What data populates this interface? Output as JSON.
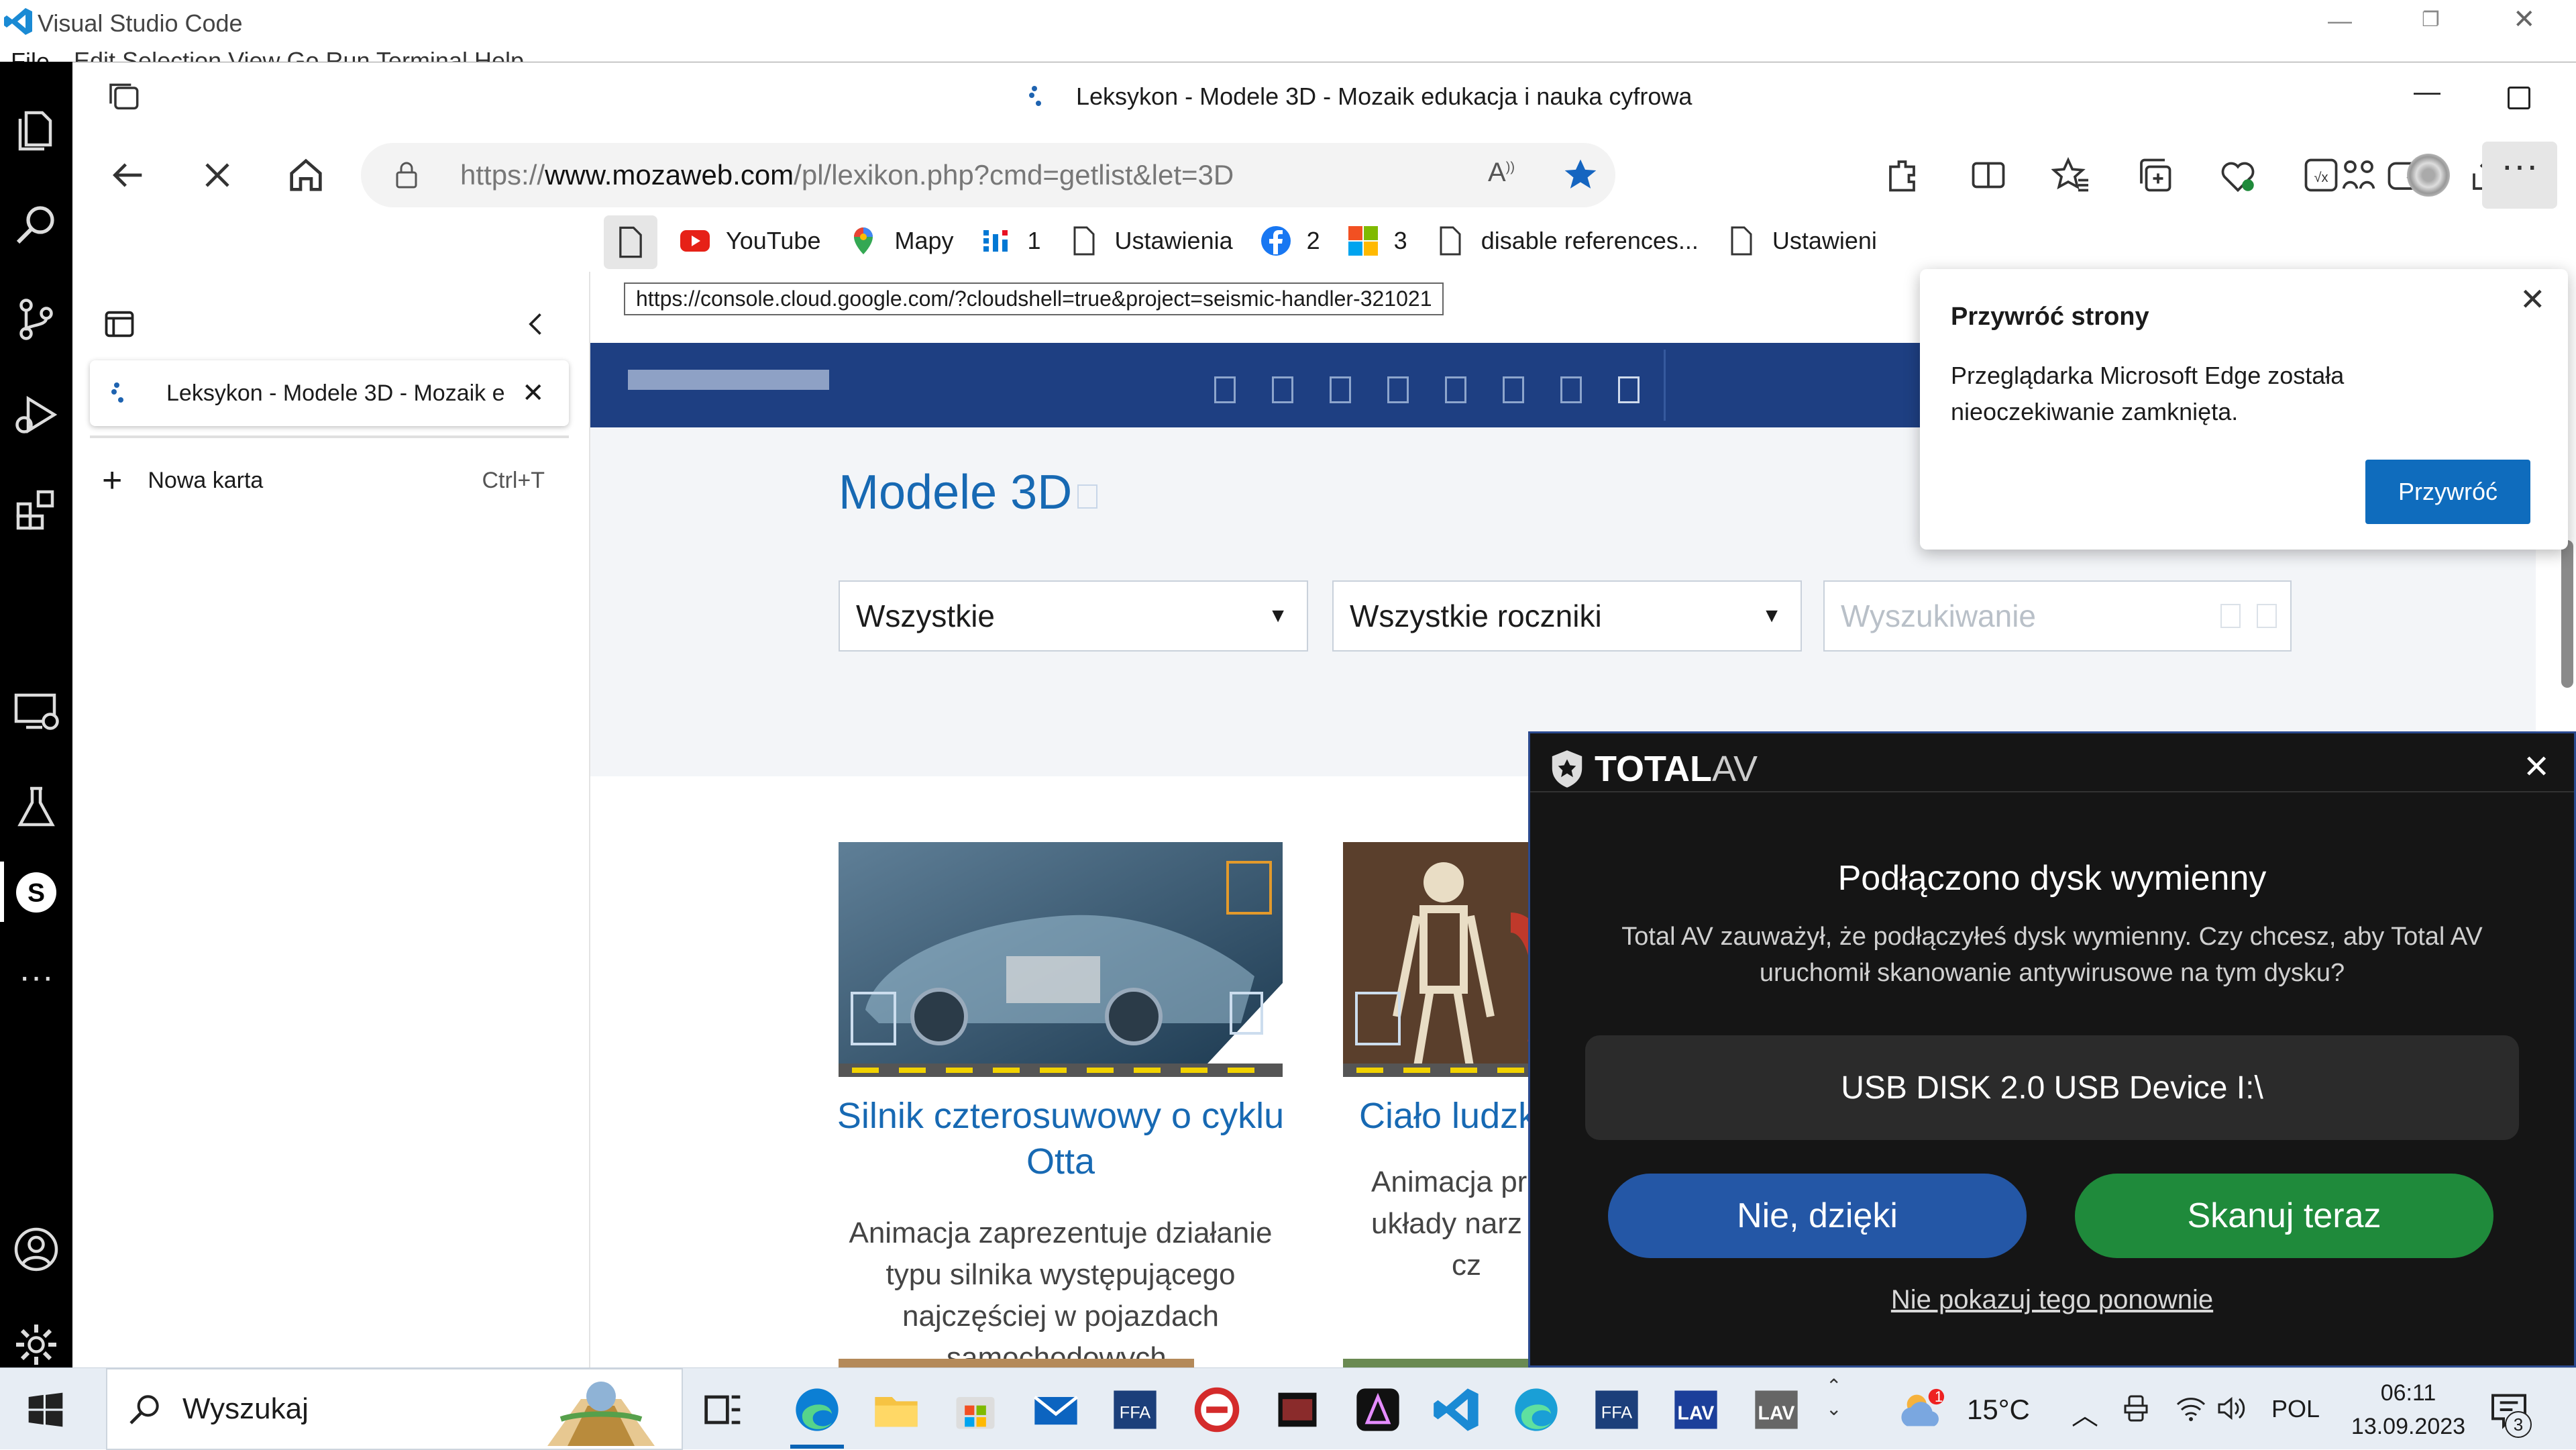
{
  "vscode": {
    "title": "Visual Studio Code",
    "menu_file": "File",
    "menu_rest": "Edit  Selection  View  Go  Run  Terminal  Help"
  },
  "edge": {
    "tab_title": "Leksykon - Modele 3D - Mozaik edukacja i nauka cyfrowa",
    "url_prefix": "https://",
    "url_domain": "www.mozaweb.com",
    "url_path": "/pl/lexikon.php?cmd=getlist&let=3D",
    "favorites": [
      {
        "label": "YouTube",
        "icon": "youtube-icon"
      },
      {
        "label": "Mapy",
        "icon": "maps-pin-icon"
      },
      {
        "label": "1",
        "icon": "app-grid-icon"
      },
      {
        "label": "Ustawienia",
        "icon": "page-icon"
      },
      {
        "label": "2",
        "icon": "facebook-icon"
      },
      {
        "label": "3",
        "icon": "microsoft-logo-icon"
      },
      {
        "label": "disable references...",
        "icon": "page-icon"
      },
      {
        "label": "Ustawieni",
        "icon": "page-icon"
      }
    ],
    "hover_url": "https://console.cloud.google.com/?cloudshell=true&project=seismic-handler-321021",
    "sidebar": {
      "tab_label": "Leksykon - Modele 3D - Mozaik e",
      "new_tab_label": "Nowa karta",
      "new_tab_shortcut": "Ctrl+T"
    },
    "restore_popup": {
      "title": "Przywróć strony",
      "body": "Przeglądarka Microsoft Edge została nieoczekiwanie zamknięta.",
      "button": "Przywróć"
    }
  },
  "page": {
    "heading": "Modele 3D",
    "filter_subject": "Wszystkie",
    "filter_year": "Wszystkie roczniki",
    "search_placeholder": "Wyszukiwanie",
    "cards": [
      {
        "title": "Silnik czterosuwowy o cyklu Otta",
        "desc": "Animacja zaprezentuje działanie typu silnika występującego najczęściej w pojazdach samochodowych."
      },
      {
        "title": "Ciało ludzk",
        "desc_line1": "Animacja pr",
        "desc_line2": "układy narz",
        "desc_line3": "cz"
      }
    ]
  },
  "totalav": {
    "brand_bold": "TOTAL",
    "brand_light": "AV",
    "heading": "Podłączono dysk wymienny",
    "body": "Total AV zauważył, że podłączyłeś dysk wymienny. Czy chcesz, aby Total AV uruchomił skanowanie antywirusowe na tym dysku?",
    "device": "USB DISK 2.0 USB Device I:\\",
    "btn_no": "Nie, dzięki",
    "btn_scan": "Skanuj teraz",
    "dont_show": "Nie pokazuj tego ponownie",
    "colors": {
      "no": "#2457a6",
      "scan": "#1f8a3b"
    }
  },
  "taskbar": {
    "search_label": "Wyszukaj",
    "weather_temp": "15°C",
    "weather_badge": "1",
    "language": "POL",
    "time": "06:11",
    "date": "13.09.2023",
    "notification_count": "3"
  }
}
